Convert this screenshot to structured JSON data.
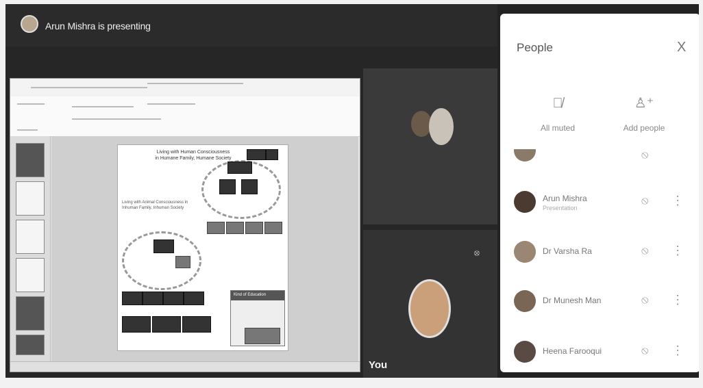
{
  "header": {
    "presenting_text": "Arun Mishra is presenting"
  },
  "slide": {
    "title_line1": "Living with Human Consciousness",
    "title_line2": "in Humane Family, Humane Society",
    "side_text": "Living with Animal Consciousness in Inhuman Family, Inhuman Society",
    "legend_title": "Kind of Education"
  },
  "tile": {
    "you_label": "You"
  },
  "panel": {
    "title": "People",
    "close": "X",
    "actions": [
      {
        "label": "All muted",
        "icon": "mic-off-icon"
      },
      {
        "label": "Add people",
        "icon": "add-person-icon"
      }
    ],
    "participants": [
      {
        "name": "",
        "subtitle": ""
      },
      {
        "name": "Arun Mishra",
        "subtitle": "Presentation"
      },
      {
        "name": "Dr Varsha Ra",
        "subtitle": ""
      },
      {
        "name": "Dr Munesh Man",
        "subtitle": ""
      },
      {
        "name": "Heena Farooqui",
        "subtitle": ""
      }
    ]
  },
  "colors": {
    "background": "#222222",
    "panel": "#ffffff"
  }
}
